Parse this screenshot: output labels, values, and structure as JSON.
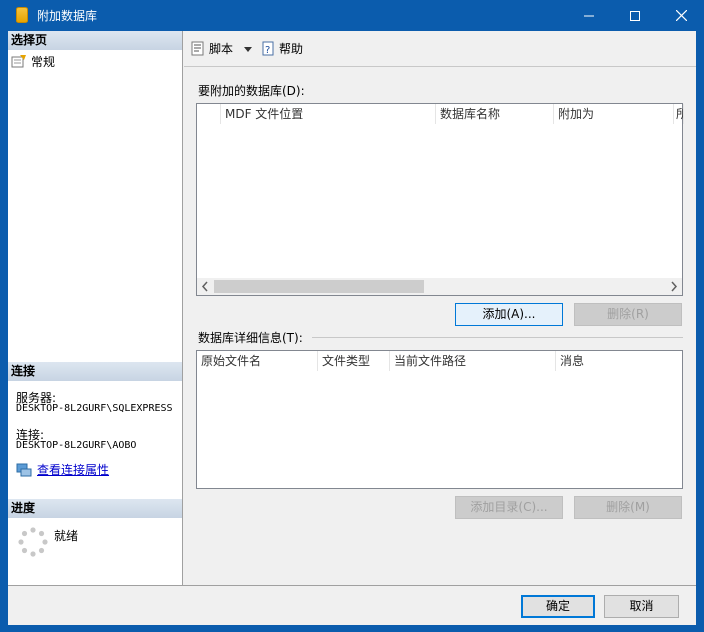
{
  "window": {
    "title": "附加数据库",
    "icon": "database-cylinder-icon"
  },
  "left": {
    "select_page_header": "选择页",
    "nav_items": [
      {
        "label": "常规",
        "icon": "general-page-icon"
      }
    ],
    "connection_header": "连接",
    "server_label": "服务器:",
    "server_value": "DESKTOP-8L2GURF\\SQLEXPRESS",
    "connection_label": "连接:",
    "connection_value": "DESKTOP-8L2GURF\\AOBO",
    "view_props_link": "查看连接属性",
    "progress_header": "进度",
    "progress_status": "就绪"
  },
  "toolbar": {
    "script_label": "脚本",
    "help_label": "帮助"
  },
  "attach": {
    "label": "要附加的数据库(D):",
    "columns": [
      "MDF 文件位置",
      "数据库名称",
      "附加为",
      "所"
    ],
    "add_button": "添加(A)...",
    "remove_button": "删除(R)"
  },
  "details": {
    "label": "数据库详细信息(T):",
    "columns": [
      "原始文件名",
      "文件类型",
      "当前文件路径",
      "消息"
    ],
    "add_catalog_button": "添加目录(C)...",
    "remove_button": "删除(M)"
  },
  "footer": {
    "ok_button": "确定",
    "cancel_button": "取消"
  }
}
